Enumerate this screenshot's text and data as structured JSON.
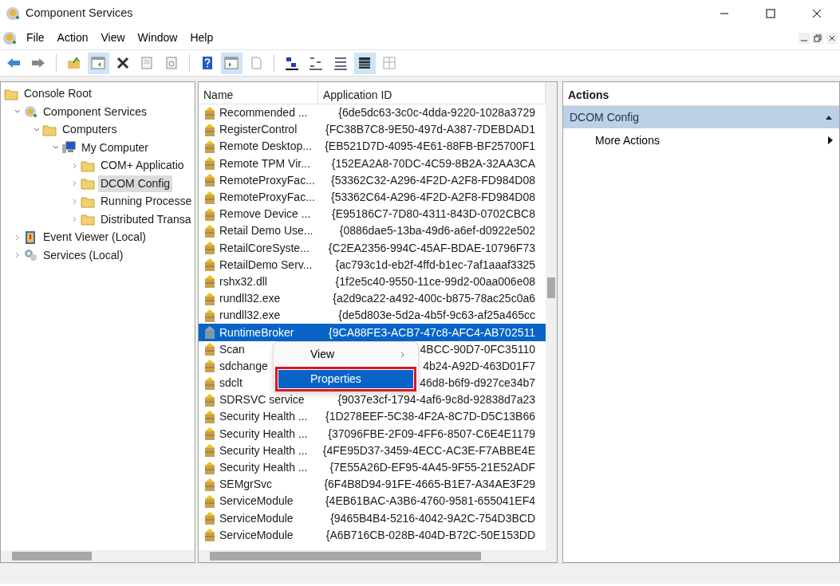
{
  "window": {
    "title": "Component Services"
  },
  "menu": [
    "File",
    "Action",
    "View",
    "Window",
    "Help"
  ],
  "toolbar": [
    {
      "kind": "back",
      "pressed": false
    },
    {
      "kind": "forward",
      "pressed": false
    },
    {
      "kind": "sep"
    },
    {
      "kind": "up",
      "pressed": false
    },
    {
      "kind": "tree",
      "pressed": true
    },
    {
      "kind": "delete",
      "pressed": false
    },
    {
      "kind": "properties",
      "pressed": false
    },
    {
      "kind": "refresh",
      "pressed": false
    },
    {
      "kind": "sep"
    },
    {
      "kind": "help",
      "pressed": false
    },
    {
      "kind": "pane",
      "pressed": true
    },
    {
      "kind": "export",
      "pressed": false
    },
    {
      "kind": "sep"
    },
    {
      "kind": "largeicons",
      "pressed": false
    },
    {
      "kind": "smallicons",
      "pressed": false
    },
    {
      "kind": "list",
      "pressed": false
    },
    {
      "kind": "details",
      "pressed": true
    },
    {
      "kind": "status",
      "pressed": false
    }
  ],
  "tree": [
    {
      "label": "Console Root",
      "kind": "folder",
      "selected": false,
      "children": [
        {
          "label": "Component Services",
          "kind": "gear",
          "expanded": true,
          "selected": false,
          "children": [
            {
              "label": "Computers",
              "kind": "folder",
              "expanded": true,
              "selected": false,
              "children": [
                {
                  "label": "My Computer",
                  "kind": "computer",
                  "expanded": true,
                  "selected": false,
                  "children": [
                    {
                      "label": "COM+ Applicatio",
                      "kind": "folder",
                      "expanded": false,
                      "selected": false
                    },
                    {
                      "label": "DCOM Config",
                      "kind": "folder",
                      "expanded": false,
                      "selected": true
                    },
                    {
                      "label": "Running Processe",
                      "kind": "folder",
                      "expanded": false,
                      "selected": false
                    },
                    {
                      "label": "Distributed Transa",
                      "kind": "folder",
                      "expanded": false,
                      "selected": false
                    }
                  ]
                }
              ]
            }
          ]
        },
        {
          "label": "Event Viewer (Local)",
          "kind": "event",
          "expanded": false,
          "selected": false
        },
        {
          "label": "Services (Local)",
          "kind": "services",
          "expanded": false,
          "selected": false
        }
      ]
    }
  ],
  "table": {
    "columns": [
      "Name",
      "Application ID"
    ],
    "rows": [
      {
        "name": "Recommended ...",
        "id": "{6de5dc63-3c0c-4dda-9220-1028a3729",
        "selected": false
      },
      {
        "name": "RegisterControl",
        "id": "{FC38B7C8-9E50-497d-A387-7DEBDAD1",
        "selected": false
      },
      {
        "name": "Remote Desktop...",
        "id": "{EB521D7D-4095-4E61-88FB-BF25700F1",
        "selected": false
      },
      {
        "name": "Remote TPM Vir...",
        "id": "{152EA2A8-70DC-4C59-8B2A-32AA3CA",
        "selected": false
      },
      {
        "name": "RemoteProxyFac...",
        "id": "{53362C32-A296-4F2D-A2F8-FD984D08",
        "selected": false
      },
      {
        "name": "RemoteProxyFac...",
        "id": "{53362C64-A296-4F2D-A2F8-FD984D08",
        "selected": false
      },
      {
        "name": "Remove Device ...",
        "id": "{E95186C7-7D80-4311-843D-0702CBC8",
        "selected": false
      },
      {
        "name": "Retail Demo Use...",
        "id": "{0886dae5-13ba-49d6-a6ef-d0922e502",
        "selected": false
      },
      {
        "name": "RetailCoreSyste...",
        "id": "{C2EA2356-994C-45AF-BDAE-10796F73",
        "selected": false
      },
      {
        "name": "RetailDemo Serv...",
        "id": "{ac793c1d-eb2f-4ffd-b1ec-7af1aaaf3325",
        "selected": false
      },
      {
        "name": "rshx32.dll",
        "id": "{1f2e5c40-9550-11ce-99d2-00aa006e08",
        "selected": false
      },
      {
        "name": "rundll32.exe",
        "id": "{a2d9ca22-a492-400c-b875-78ac25c0a6",
        "selected": false
      },
      {
        "name": "rundll32.exe",
        "id": "{de5d803e-5d2a-4b5f-9c63-af25a465cc",
        "selected": false
      },
      {
        "name": "RuntimeBroker",
        "id": "{9CA88FE3-ACB7-47c8-AFC4-AB702511",
        "selected": true
      },
      {
        "name": "Scan",
        "id": "4BCC-90D7-0FC35110",
        "selected": false
      },
      {
        "name": "sdchange",
        "id": "4b24-A92D-463D01F7",
        "selected": false
      },
      {
        "name": "sdclt",
        "id": "46d8-b6f9-d927ce34b7",
        "selected": false
      },
      {
        "name": "SDRSVC service",
        "id": "{9037e3cf-1794-4af6-9c8d-92838d7a23",
        "selected": false
      },
      {
        "name": "Security Health ...",
        "id": "{1D278EEF-5C38-4F2A-8C7D-D5C13B66",
        "selected": false
      },
      {
        "name": "Security Health ...",
        "id": "{37096FBE-2F09-4FF6-8507-C6E4E1179",
        "selected": false
      },
      {
        "name": "Security Health ...",
        "id": "{4FE95D37-3459-4ECC-AC3E-F7ABBE4E",
        "selected": false
      },
      {
        "name": "Security Health ...",
        "id": "{7E55A26D-EF95-4A45-9F55-21E52ADF",
        "selected": false
      },
      {
        "name": "SEMgrSvc",
        "id": "{6F4B8D94-91FE-4665-B1E7-A34AE3F29",
        "selected": false
      },
      {
        "name": "ServiceModule",
        "id": "{4EB61BAC-A3B6-4760-9581-655041EF4",
        "selected": false
      },
      {
        "name": "ServiceModule",
        "id": "{9465B4B4-5216-4042-9A2C-754D3BCD",
        "selected": false
      },
      {
        "name": "ServiceModule",
        "id": "{A6B716CB-028B-404D-B72C-50E153DD",
        "selected": false
      }
    ]
  },
  "context_menu": [
    {
      "label": "View",
      "submenu": true,
      "selected": false
    },
    {
      "label": "Properties",
      "submenu": false,
      "selected": true
    }
  ],
  "actions": {
    "title": "Actions",
    "groups": [
      {
        "label": "DCOM Config",
        "expanded": true,
        "items": [
          {
            "label": "More Actions",
            "submenu": true
          }
        ]
      }
    ]
  }
}
